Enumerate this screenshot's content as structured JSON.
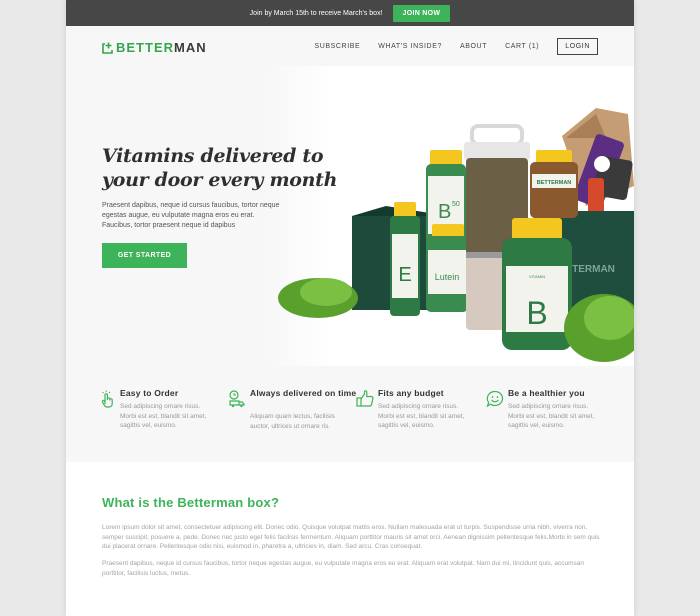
{
  "promo": {
    "text": "Join by March 15th to receive March's box!",
    "button": "JOIN NOW"
  },
  "brand": {
    "part1": "BETTER",
    "part2": "MAN",
    "accent_color": "#3db35a"
  },
  "nav": {
    "items": [
      "SUBSCRIBE",
      "WHAT'S INSIDE?",
      "ABOUT",
      "CART (1)"
    ],
    "login": "LOGIN"
  },
  "hero": {
    "title": "Vitamins delivered to your door every month",
    "subtitle": "Praesent dapibus, neque id cursus faucibus, tortor neque egestas augue, eu vulputate magna eros eu erat. Faucibus, tortor praesent neque id dapibus",
    "cta": "GET STARTED",
    "bottle_labels": {
      "e": "E",
      "b50": "B",
      "b50_sup": "50",
      "lutein": "Lutein",
      "b": "B",
      "box_brand": "BETTERMAN",
      "box_right": "TTERMAN",
      "vitamin": "VITAMIN"
    }
  },
  "features": [
    {
      "icon": "hand-pointer-icon",
      "title": "Easy to Order",
      "text": "Sed adipiscing ornare risus. Morbi est est, blandit sit amet, sagittis vel, euismo."
    },
    {
      "icon": "delivery-truck-icon",
      "title": "Always delivered on time",
      "text": "Aliquam quam lectus, facilisis auctor, ultrices ut ornare ris."
    },
    {
      "icon": "thumbs-up-icon",
      "title": "Fits any budget",
      "text": "Sed adipiscing ornare risus. Morbi est est, blandit sit amet, sagittis vel, euismo."
    },
    {
      "icon": "smiley-chat-icon",
      "title": "Be a healthier you",
      "text": "Sed adipiscing ornare risus. Morbi est est, blandit sit amet, sagittis vel, euismo."
    }
  ],
  "about": {
    "title": "What is the Betterman box?",
    "p1": "Lorem ipsum dolor sit amet, consectetuer adipiscing elit. Donec odio. Quisque volutpat mattis eros. Nullam malesuada erat ut turpis. Suspendisse urna nibh, viverra non, semper suscipit, posuere a, pede. Donec nec justo eget felis facilisis fermentum. Aliquam porttitor mauris sit amet orci. Aenean dignissim pellentesque felis.Morbi in sem quis dui placerat ornare. Pellentesque odio nisi, euismod in, pharetra a, ultricies in, diam. Sed arcu. Cras consequat.",
    "p2": "Praesent dapibus, neque id cursus faucibus, tortor neque egestas augue, eu vulputate magna eros eu erat. Aliquam erat volutpat. Nam dui mi, tincidunt quis, accumsan porttitor, facilisis luctus, metus."
  }
}
